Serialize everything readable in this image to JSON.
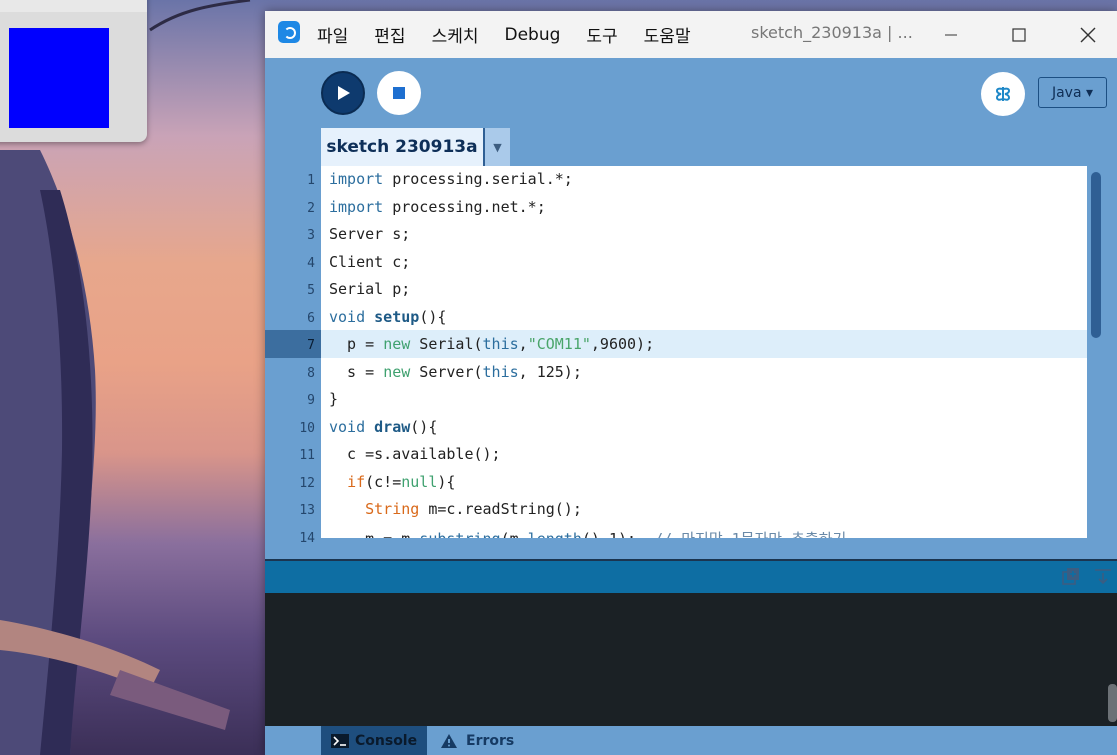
{
  "menu": {
    "items": [
      "파일",
      "편집",
      "스케치",
      "Debug",
      "도구",
      "도움말"
    ]
  },
  "window": {
    "title": "sketch_230913a | ..."
  },
  "toolbar": {
    "mode": "Java ▾"
  },
  "tabs": {
    "active": "sketch 230913a",
    "menu_glyph": "▼"
  },
  "editor": {
    "line_numbers": [
      "1",
      "2",
      "3",
      "4",
      "5",
      "6",
      "7",
      "8",
      "9",
      "10",
      "11",
      "12",
      "13",
      "14"
    ],
    "current_line": "7"
  },
  "bottom_tabs": {
    "console": "Console",
    "errors": "Errors"
  },
  "colors": {
    "accent": "#6a9fd0",
    "console_bg": "#1b2125",
    "sketch_square": "#0000ff"
  }
}
